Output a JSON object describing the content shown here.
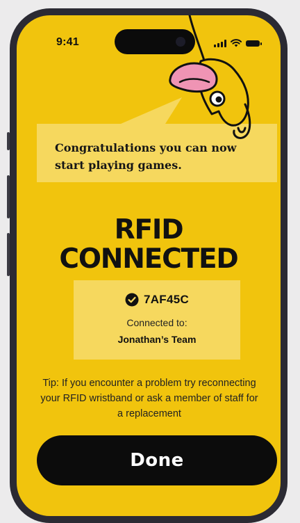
{
  "status_bar": {
    "time": "9:41"
  },
  "speech": {
    "text": "Congratulations you can now start playing games."
  },
  "title": {
    "line1": "RFID",
    "line2": "CONNECTED"
  },
  "rfid": {
    "id": "7AF45C",
    "connected_label": "Connected to:",
    "team": "Jonathan’s Team"
  },
  "tip": {
    "text": "Tip: If you encounter a problem try reconnecting your RFID wristband or ask a member of staff for a replacement"
  },
  "done_button": {
    "label": "Done"
  },
  "colors": {
    "background": "#f1c40d",
    "card": "#f6d85e",
    "button": "#0c0c0c",
    "mascot_hat": "#ef94b4"
  },
  "icons": [
    "signal-icon",
    "wifi-icon",
    "battery-icon",
    "check-circle-icon",
    "mascot-illustration"
  ]
}
